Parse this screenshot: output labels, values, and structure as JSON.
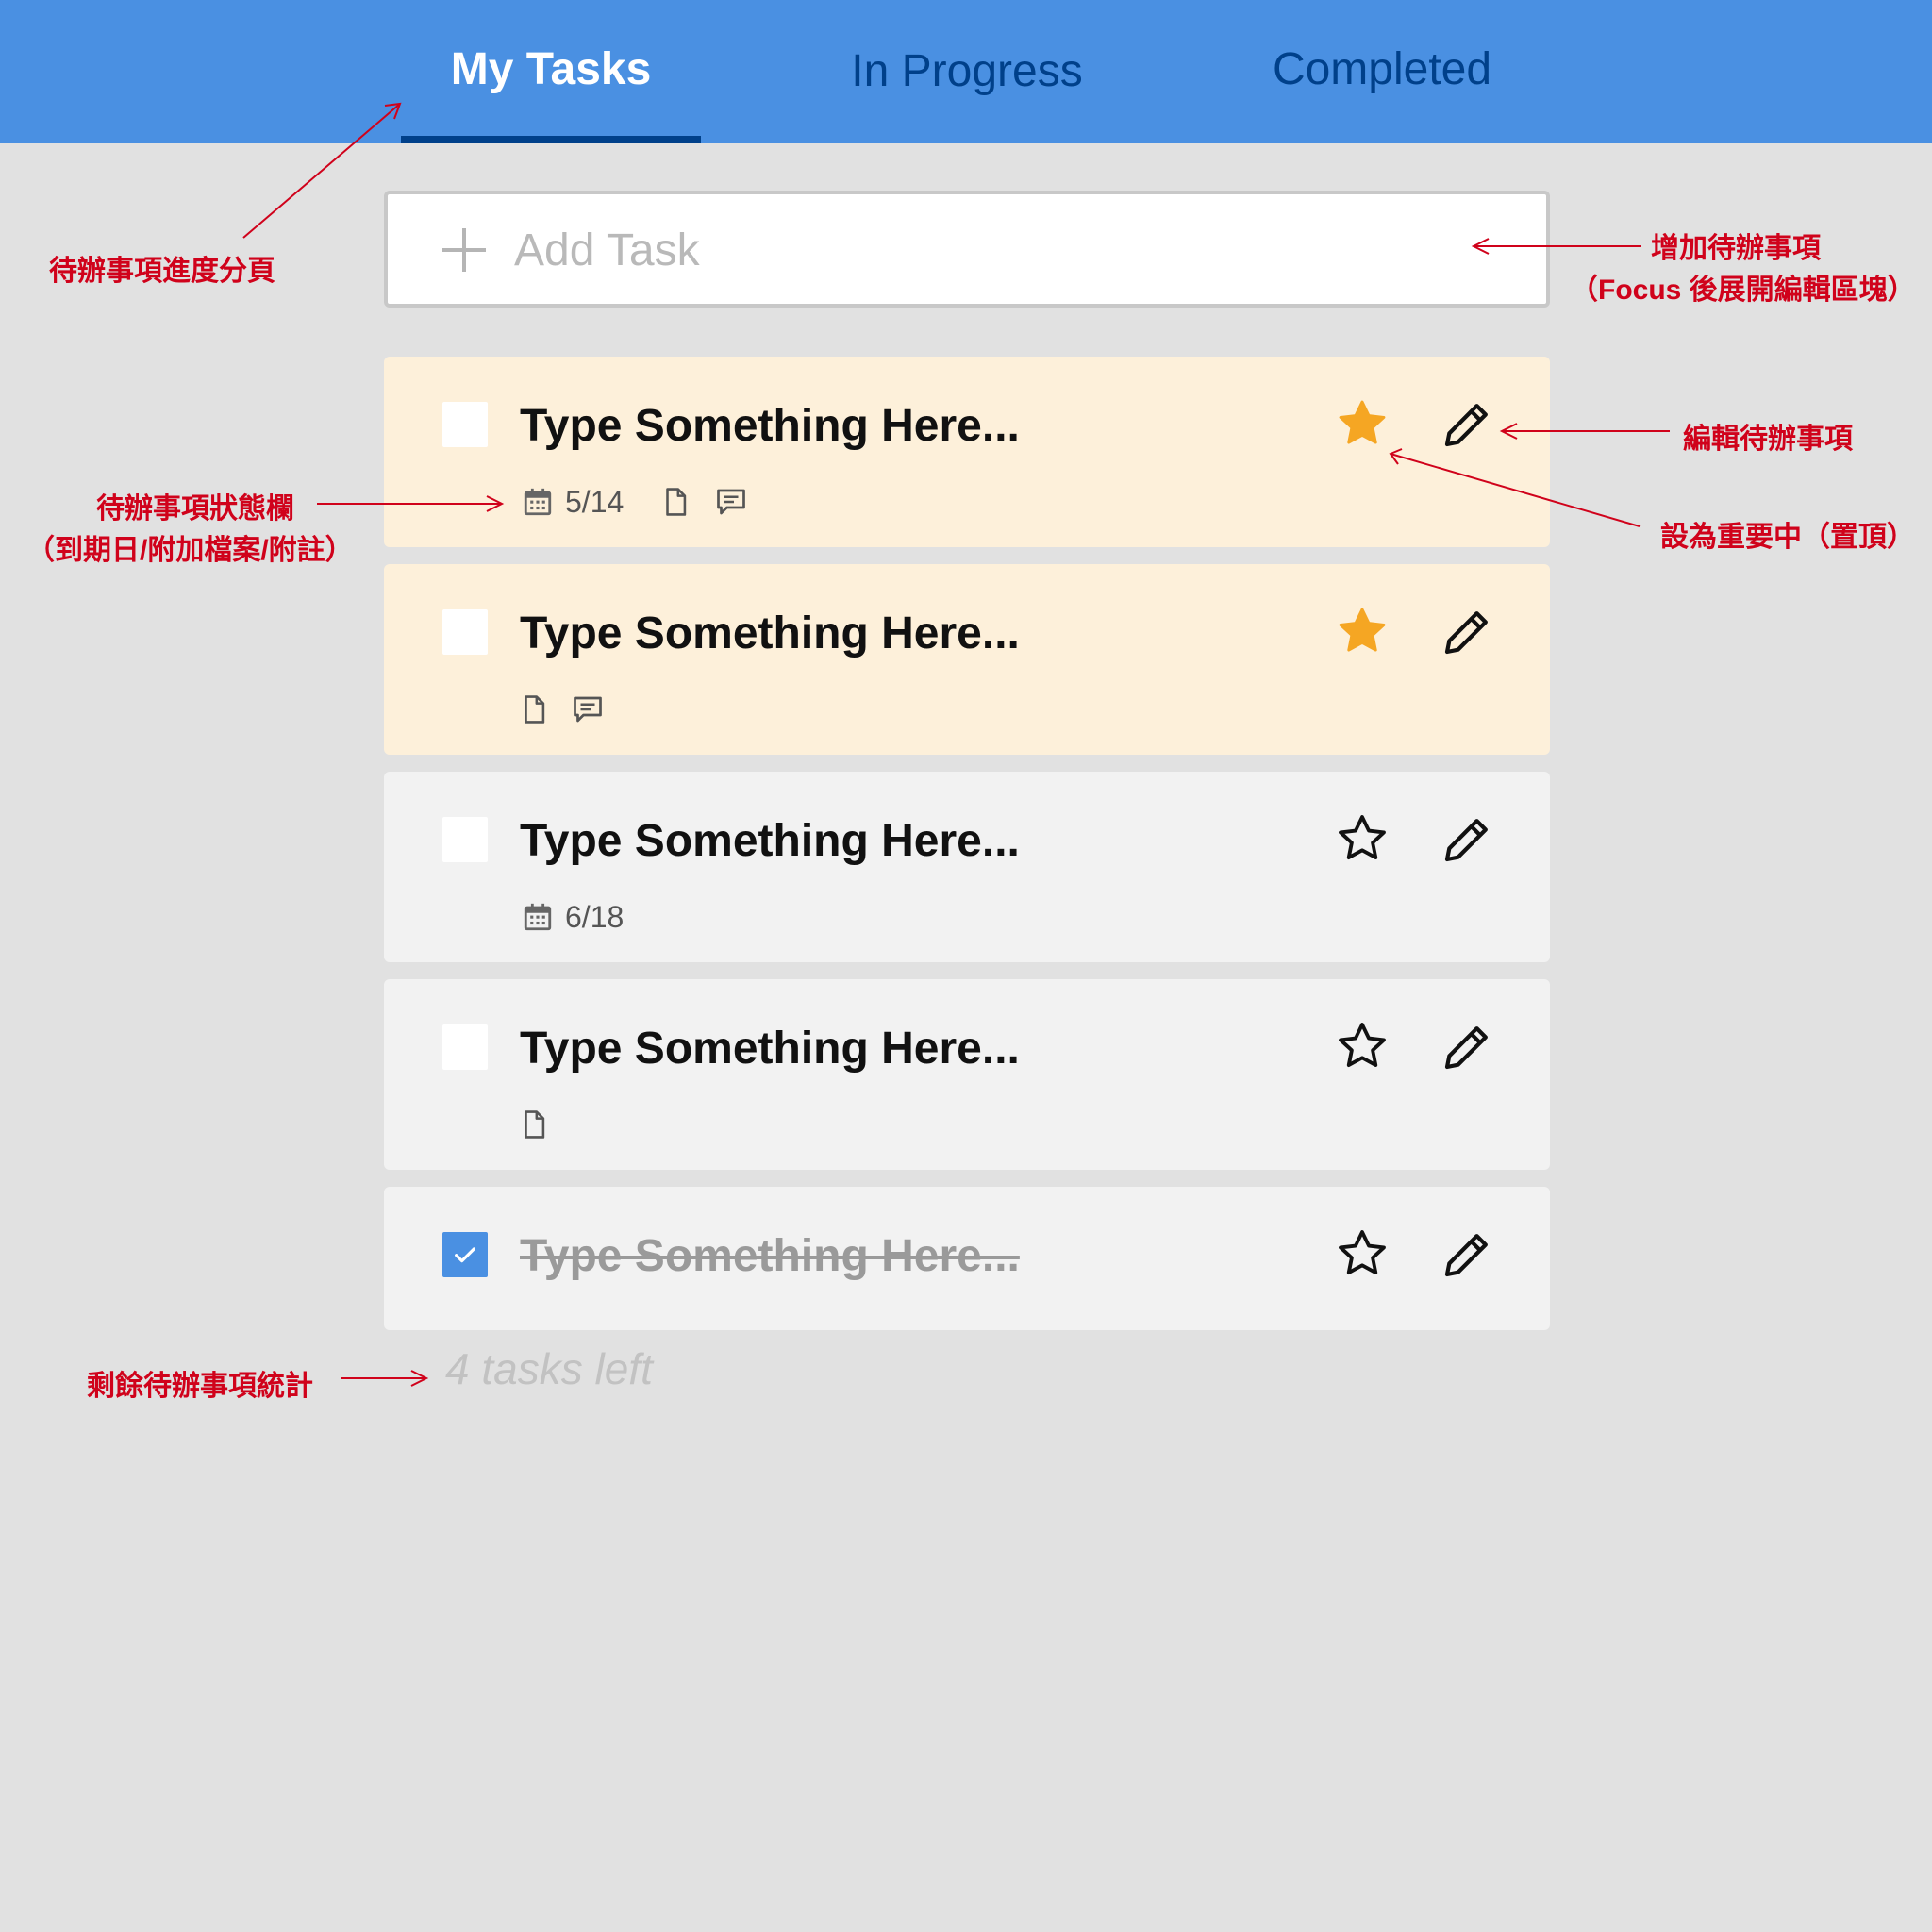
{
  "tabs": [
    {
      "label": "My Tasks",
      "active": true
    },
    {
      "label": "In Progress",
      "active": false
    },
    {
      "label": "Completed",
      "active": false
    }
  ],
  "add_task": {
    "placeholder": "Add Task",
    "icon": "plus-icon"
  },
  "tasks": [
    {
      "title": "Type Something Here...",
      "important": true,
      "done": false,
      "date": "5/14",
      "has_file": true,
      "has_comment": true
    },
    {
      "title": "Type Something Here...",
      "important": true,
      "done": false,
      "date": "",
      "has_file": true,
      "has_comment": true
    },
    {
      "title": "Type Something Here...",
      "important": false,
      "done": false,
      "date": "6/18",
      "has_file": false,
      "has_comment": false
    },
    {
      "title": "Type Something Here...",
      "important": false,
      "done": false,
      "date": "",
      "has_file": true,
      "has_comment": false
    },
    {
      "title": "Type Something Here...",
      "important": false,
      "done": true,
      "date": "",
      "has_file": false,
      "has_comment": false
    }
  ],
  "footer": {
    "count_text": "4 tasks left"
  },
  "annotations": {
    "tabs_note": "待辦事項進度分頁",
    "add_note_1": "增加待辦事項",
    "add_note_2": "（Focus 後展開編輯區塊）",
    "edit_note": "編輯待辦事項",
    "star_note": "設為重要中（置頂）",
    "status_note_1": "待辦事項狀態欄",
    "status_note_2": "（到期日/附加檔案/附註）",
    "count_note": "剩餘待辦事項統計"
  },
  "colors": {
    "header": "#4a90e2",
    "tab_inactive": "#00408a",
    "important_bg": "#fdf0da",
    "task_bg": "#f2f2f2",
    "star_active": "#f5a623",
    "annotation": "#d0021b"
  }
}
